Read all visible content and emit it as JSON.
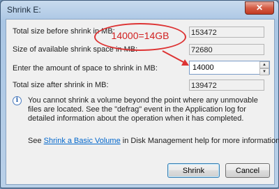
{
  "window": {
    "title": "Shrink E:",
    "close_glyph": "✕"
  },
  "fields": {
    "total_before_label": "Total size before shrink in MB:",
    "total_before_value": "153472",
    "available_label": "Size of available shrink space in MB:",
    "available_value": "72680",
    "amount_label": "Enter the amount of space to shrink in MB:",
    "amount_value": "14000",
    "total_after_label": "Total size after shrink in MB:",
    "total_after_value": "139472"
  },
  "info": {
    "icon": "info-icon",
    "icon_glyph": "i",
    "text": "You cannot shrink a volume beyond the point where any unmovable files are located. See the \"defrag\" event in the Application log for detailed information about the operation when it has completed."
  },
  "help": {
    "prefix": "See ",
    "link": "Shrink a Basic Volume",
    "suffix": " in Disk Management help for more information."
  },
  "buttons": {
    "shrink": "Shrink",
    "cancel": "Cancel"
  },
  "spin_icons": {
    "up": "▲",
    "down": "▼"
  },
  "annotation": {
    "text": "14000=14GB",
    "color": "#d12020"
  }
}
